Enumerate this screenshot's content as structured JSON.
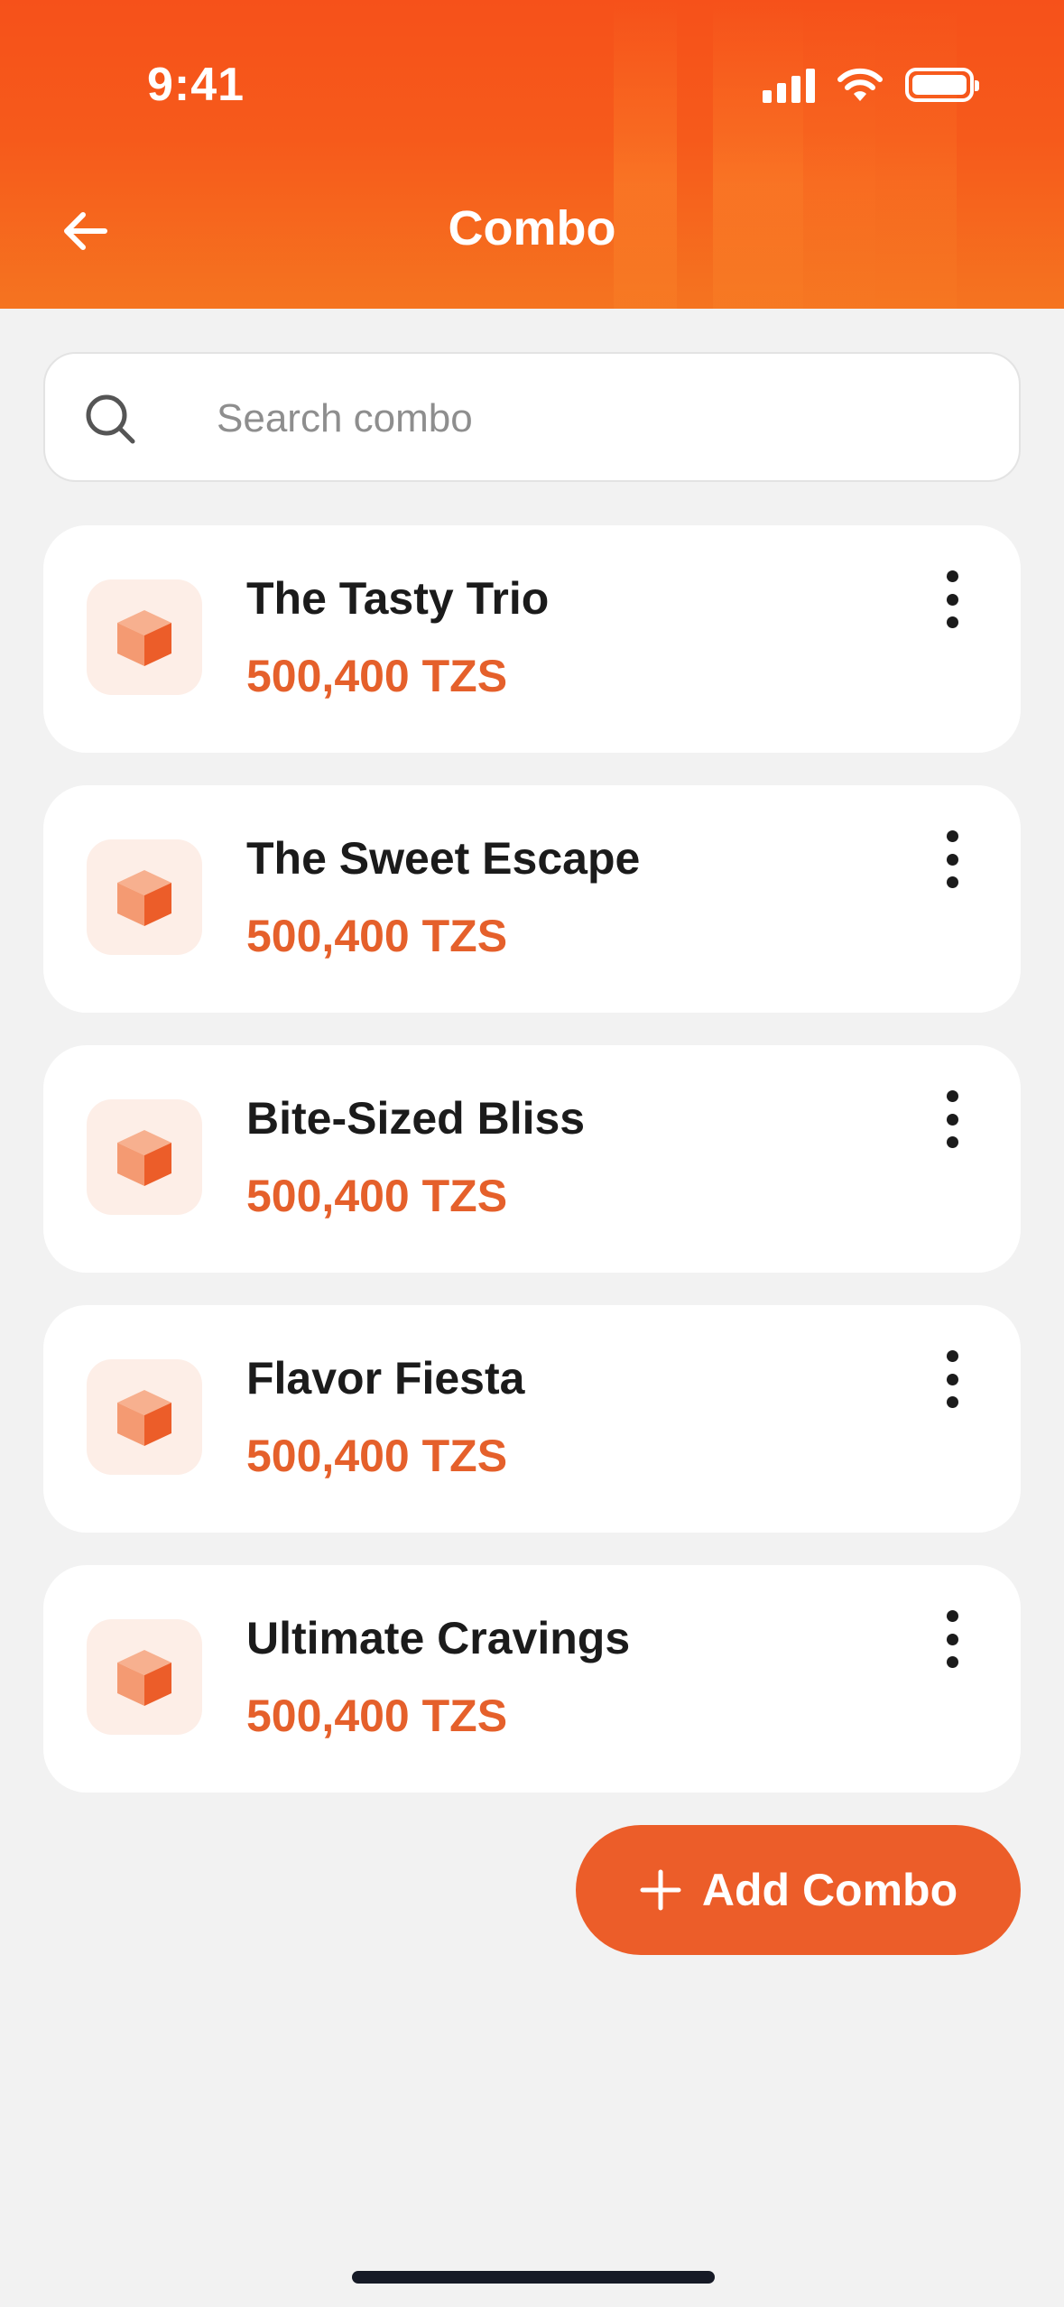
{
  "status_bar": {
    "time": "9:41"
  },
  "header": {
    "title": "Combo",
    "back_icon": "arrow-left-icon"
  },
  "search": {
    "placeholder": "Search combo",
    "value": "",
    "icon": "search-icon"
  },
  "combos": [
    {
      "name": "The Tasty Trio",
      "price": "500,400 TZS",
      "icon": "box-icon"
    },
    {
      "name": "The Sweet Escape",
      "price": "500,400 TZS",
      "icon": "box-icon"
    },
    {
      "name": "Bite-Sized Bliss",
      "price": "500,400 TZS",
      "icon": "box-icon"
    },
    {
      "name": "Flavor Fiesta",
      "price": "500,400 TZS",
      "icon": "box-icon"
    },
    {
      "name": "Ultimate Cravings",
      "price": "500,400 TZS",
      "icon": "box-icon"
    }
  ],
  "add_button": {
    "label": "Add Combo",
    "icon": "plus-icon"
  },
  "colors": {
    "header_gradient_top": "#f6511a",
    "header_gradient_bottom": "#f57420",
    "accent": "#ec5d29",
    "price": "#e5602b",
    "background": "#f2f2f2",
    "thumb_bg": "#fdeee7"
  }
}
